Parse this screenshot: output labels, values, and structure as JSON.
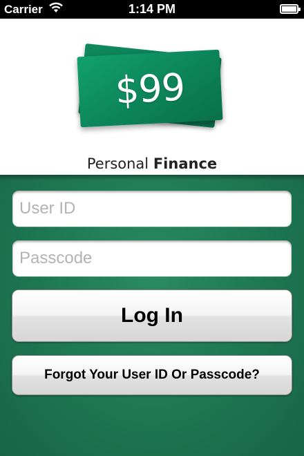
{
  "status_bar": {
    "carrier": "Carrier",
    "time": "1:14 PM",
    "wifi_icon": "wifi-icon",
    "battery_icon": "battery-icon"
  },
  "logo": {
    "price": "$99",
    "brand_light": "Personal",
    "brand_bold": "Finance",
    "bill_color": "#0c8459"
  },
  "login_form": {
    "user_id_placeholder": "User ID",
    "user_id_value": "",
    "passcode_placeholder": "Passcode",
    "passcode_value": "",
    "login_label": "Log In",
    "forgot_label": "Forgot Your User ID Or Passcode?"
  },
  "colors": {
    "panel_green": "#1f7a55",
    "header_bg": "#ffffff"
  }
}
